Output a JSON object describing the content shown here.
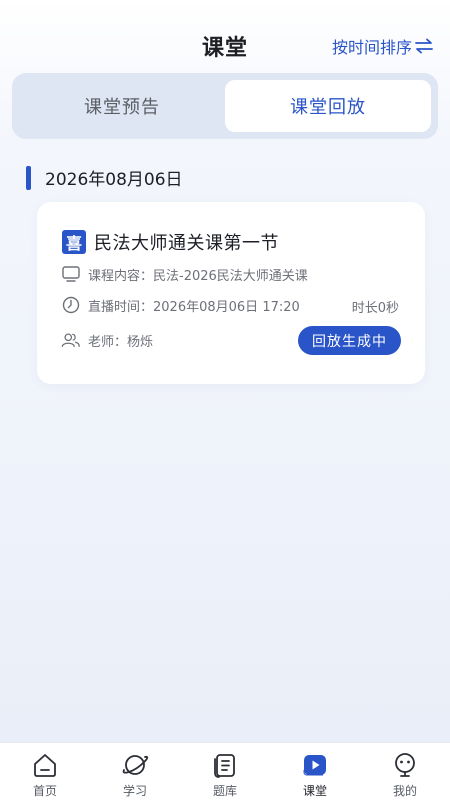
{
  "header": {
    "title": "课堂",
    "sort_label": "按时间排序",
    "sort_icon": "swap-arrows-icon"
  },
  "tabs": [
    {
      "label": "课堂预告",
      "active": false
    },
    {
      "label": "课堂回放",
      "active": true
    }
  ],
  "date_group": {
    "date": "2026年08月06日",
    "items": [
      {
        "badge": "喜",
        "title": "民法大师通关课第一节",
        "content_label": "课程内容：",
        "content_value": "民法-2026民法大师通关课",
        "time_label": "直播时间：",
        "time_value": "2026年08月06日 17:20",
        "duration": "时长0秒",
        "teacher_label": "老师：",
        "teacher_value": "杨烁",
        "status": "回放生成中"
      }
    ]
  },
  "nav": [
    {
      "label": "首页",
      "icon": "home-icon",
      "active": false
    },
    {
      "label": "学习",
      "icon": "planet-icon",
      "active": false
    },
    {
      "label": "题库",
      "icon": "document-icon",
      "active": false
    },
    {
      "label": "课堂",
      "icon": "video-play-icon",
      "active": true
    },
    {
      "label": "我的",
      "icon": "profile-icon",
      "active": false
    }
  ],
  "colors": {
    "accent": "#2a55c9",
    "tab_bg": "#dfe6f3",
    "text_secondary": "#6d7078"
  }
}
